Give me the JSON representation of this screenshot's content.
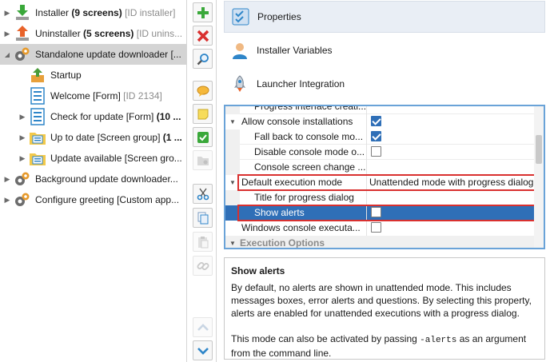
{
  "tree": {
    "nodes": [
      {
        "indent": 0,
        "expander": "▸",
        "icon": "installer-arrow-icon",
        "label_plain": "Installer ",
        "label_bold": "(9 screens)",
        "label_gray": " [ID installer]",
        "selected": false
      },
      {
        "indent": 0,
        "expander": "▸",
        "icon": "uninstaller-arrow-icon",
        "label_plain": "Uninstaller ",
        "label_bold": "(5 screens)",
        "label_gray": " [ID unins...",
        "selected": false
      },
      {
        "indent": 0,
        "expander": "◢",
        "icon": "gears-icon",
        "label_plain": "Standalone update downloader [...",
        "label_bold": "",
        "label_gray": "",
        "selected": true
      },
      {
        "indent": 1,
        "expander": "",
        "icon": "startup-icon",
        "label_plain": "Startup",
        "label_bold": "",
        "label_gray": "",
        "selected": false
      },
      {
        "indent": 1,
        "expander": "",
        "icon": "form-icon",
        "label_plain": "Welcome [Form] ",
        "label_bold": "",
        "label_gray": "[ID 2134]",
        "selected": false
      },
      {
        "indent": 1,
        "expander": "▸",
        "icon": "form-icon",
        "label_plain": "Check for update [Form] ",
        "label_bold": "(10 ...",
        "label_gray": "",
        "selected": false
      },
      {
        "indent": 1,
        "expander": "▸",
        "icon": "screen-group-icon",
        "label_plain": "Up to date [Screen group] ",
        "label_bold": "(1 ...",
        "label_gray": "",
        "selected": false
      },
      {
        "indent": 1,
        "expander": "▸",
        "icon": "screen-group-icon",
        "label_plain": "Update available [Screen gro...",
        "label_bold": "",
        "label_gray": "",
        "selected": false
      },
      {
        "indent": 0,
        "expander": "▸",
        "icon": "gears-icon",
        "label_plain": "Background update downloader...",
        "label_bold": "",
        "label_gray": "",
        "selected": false
      },
      {
        "indent": 0,
        "expander": "▸",
        "icon": "gears-icon",
        "label_plain": "Configure greeting [Custom app...",
        "label_bold": "",
        "label_gray": "",
        "selected": false
      }
    ]
  },
  "toolbar": {
    "buttons": [
      {
        "name": "add-button",
        "icon": "plus-icon",
        "disabled": false
      },
      {
        "name": "delete-button",
        "icon": "red-x-icon",
        "disabled": false
      },
      {
        "name": "search-button",
        "icon": "magnifier-icon",
        "disabled": false
      },
      {
        "name": "comment-button",
        "icon": "speech-bubble-icon",
        "disabled": false
      },
      {
        "name": "note-button",
        "icon": "sticky-note-icon",
        "disabled": false
      },
      {
        "name": "check-button",
        "icon": "green-check-icon",
        "disabled": false
      },
      {
        "name": "folder-button",
        "icon": "folder-gear-icon",
        "disabled": true
      },
      {
        "name": "cut-button",
        "icon": "scissors-icon",
        "disabled": false
      },
      {
        "name": "copy-button",
        "icon": "copy-icon",
        "disabled": false
      },
      {
        "name": "paste-button",
        "icon": "paste-icon",
        "disabled": true
      },
      {
        "name": "link-button",
        "icon": "link-icon",
        "disabled": true
      },
      {
        "name": "move-up-button",
        "icon": "chevron-up-icon",
        "disabled": true
      },
      {
        "name": "move-down-button",
        "icon": "chevron-down-icon",
        "disabled": false
      }
    ]
  },
  "tabs": [
    {
      "label": "Properties",
      "icon": "properties-icon",
      "active": true
    },
    {
      "label": "Installer Variables",
      "icon": "user-icon",
      "active": false
    },
    {
      "label": "Launcher Integration",
      "icon": "rocket-icon",
      "active": false
    }
  ],
  "grid": {
    "rows": [
      {
        "kind": "partial",
        "name": "Progress interface creati...",
        "value": ""
      },
      {
        "kind": "group",
        "name": "Allow console installations",
        "checkbox": "checked"
      },
      {
        "kind": "sub",
        "name": "Fall back to console mo...",
        "checkbox": "checked"
      },
      {
        "kind": "sub",
        "name": "Disable console mode o...",
        "checkbox": "unchecked"
      },
      {
        "kind": "sub",
        "name": "Console screen change ...",
        "value": ""
      },
      {
        "kind": "group",
        "name": "Default execution mode",
        "value": "Unattended mode with progress dialog",
        "highlight": true
      },
      {
        "kind": "sub",
        "name": "Title for progress dialog",
        "value": ""
      },
      {
        "kind": "sub",
        "name": "Show alerts",
        "checkbox": "unchecked",
        "selected": true,
        "highlight": true
      },
      {
        "kind": "plain",
        "name": "Windows console executa...",
        "checkbox": "unchecked"
      },
      {
        "kind": "section",
        "name": "Execution Options",
        "value": ""
      }
    ]
  },
  "description": {
    "title": "Show alerts",
    "para1": "By default, no alerts are shown in unattended mode. This includes messages boxes, error alerts and questions. By selecting this property, alerts are enabled for unattended executions with a progress dialog.",
    "para2_before": "This mode can also be activated by passing ",
    "para2_code": "-alerts",
    "para2_after": " as an argument from the command line."
  },
  "colors": {
    "selection_blue": "#2f6fb7",
    "highlight_red": "#d9302f",
    "grid_border": "#6aa3d8",
    "tab_active_bg": "#e9eef5"
  }
}
